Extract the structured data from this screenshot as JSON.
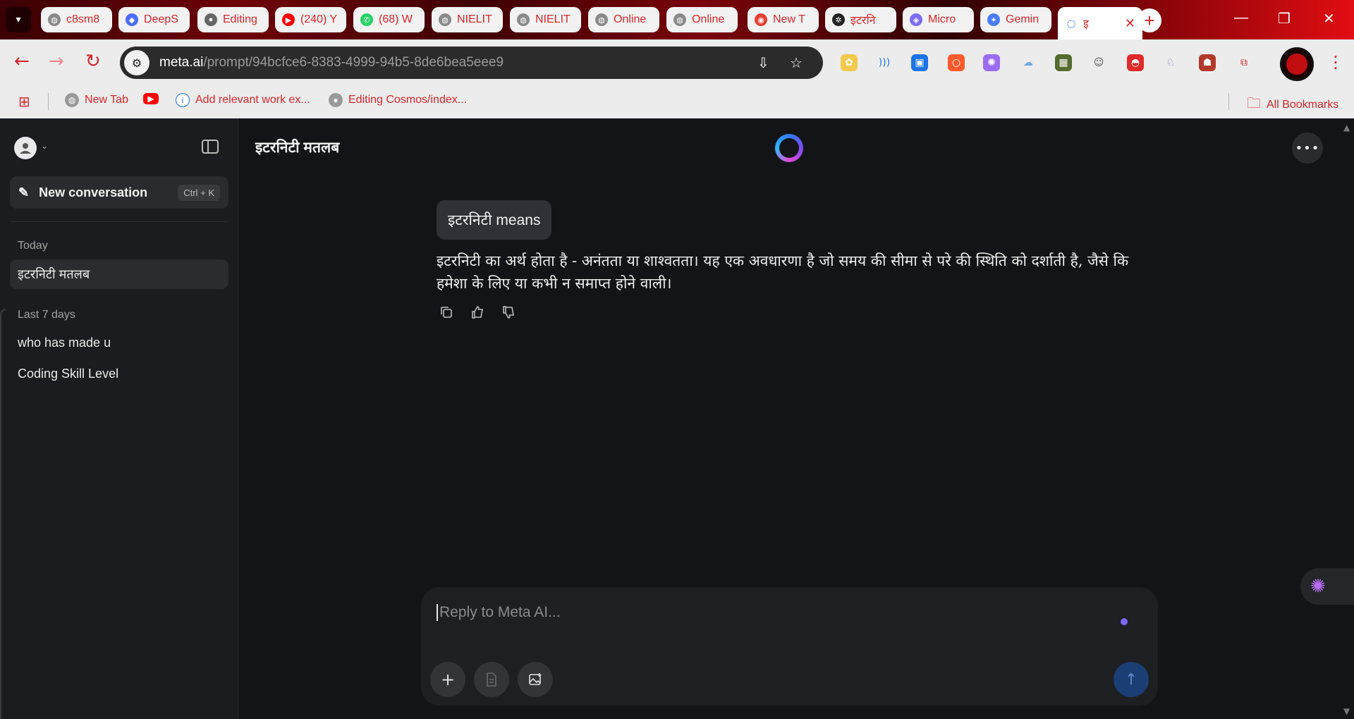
{
  "browser": {
    "tabs": [
      {
        "title": "c8sm8",
        "icon": "globe-icon",
        "color": "#8a8a8a"
      },
      {
        "title": "DeepS",
        "icon": "deepseek-icon",
        "color": "#4d6bfe"
      },
      {
        "title": "Editing",
        "icon": "github-icon",
        "color": "#666666"
      },
      {
        "title": "(240) Y",
        "icon": "youtube-icon",
        "color": "#ff0000"
      },
      {
        "title": "(68) W",
        "icon": "whatsapp-icon",
        "color": "#25d366"
      },
      {
        "title": "NIELIT",
        "icon": "globe-icon",
        "color": "#8a8a8a"
      },
      {
        "title": "NIELIT",
        "icon": "globe-icon",
        "color": "#8a8a8a"
      },
      {
        "title": "Online",
        "icon": "globe-icon",
        "color": "#8a8a8a"
      },
      {
        "title": "Online",
        "icon": "globe-icon",
        "color": "#8a8a8a"
      },
      {
        "title": "New T",
        "icon": "chrome-icon",
        "color": "#e34133"
      },
      {
        "title": "इटरनि",
        "icon": "chatgpt-icon",
        "color": "#222222"
      },
      {
        "title": "Micro",
        "icon": "copilot-icon",
        "color": "#7c6cf2"
      },
      {
        "title": "Gemin",
        "icon": "gemini-icon",
        "color": "#4a7cf6"
      },
      {
        "title": "इ",
        "icon": "meta-ai-icon",
        "color": "#3b82f6",
        "active": true
      }
    ],
    "new_tab_symbol": "+",
    "window_controls": {
      "minimize": "—",
      "restore": "❐",
      "close": "✕"
    },
    "url_host": "meta.ai",
    "url_path": "/prompt/94bcfce6-8383-4999-94b5-8de6bea5eee9",
    "bookmarks": [
      {
        "label": "",
        "icon": "apps-grid-icon"
      },
      {
        "label": "New Tab",
        "icon": "globe-icon"
      },
      {
        "label": "",
        "icon": "youtube-icon"
      },
      {
        "label": "Add relevant work ex...",
        "icon": "info-icon"
      },
      {
        "label": "Editing Cosmos/index...",
        "icon": "github-icon"
      }
    ],
    "all_bookmarks": "All Bookmarks",
    "accent": "#d5262b"
  },
  "sidebar": {
    "new_conversation": "New conversation",
    "shortcut": "Ctrl + K",
    "sections": [
      {
        "label": "Today",
        "items": [
          "इटरनिटी मतलब"
        ]
      },
      {
        "label": "Last 7 days",
        "items": [
          "who has made u",
          "Coding Skill Level"
        ]
      }
    ]
  },
  "chat": {
    "title": "इटरनिटी मतलब",
    "user_message": "इटरनिटी means",
    "assistant_message": "इटरनिटी का अर्थ होता है - अनंतता या शाश्वतता। यह एक अवधारणा है जो समय की सीमा से परे की स्थिति को दर्शाती है, जैसे कि हमेशा के लिए या कभी न समाप्त होने वाली।",
    "actions": [
      "copy-icon",
      "thumbs-up-icon",
      "thumbs-down-icon"
    ]
  },
  "composer": {
    "placeholder": "Reply to Meta AI...",
    "add_symbol": "+",
    "send_symbol": "↑"
  }
}
